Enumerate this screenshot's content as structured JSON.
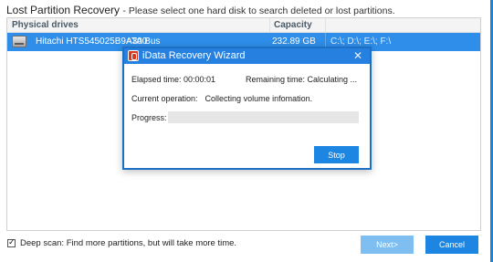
{
  "page": {
    "title": "Lost Partition Recovery",
    "subtitle": "- Please select one hard disk to search deleted or lost partitions."
  },
  "drives_table": {
    "columns": [
      "Physical drives",
      "Capacity"
    ],
    "rows": [
      {
        "name": "Hitachi HTS545025B9A300",
        "bus": "ATA Bus",
        "capacity": "232.89 GB",
        "partitions": "C:\\; D:\\; E:\\; F:\\",
        "icon": "hard-drive-icon",
        "selected": true
      }
    ]
  },
  "dialog": {
    "title": "iData Recovery Wizard",
    "icon": "app-icon",
    "close_glyph": "✕",
    "elapsed": "Elapsed time: 00:00:01",
    "remaining": "Remaining time: Calculating ...",
    "operation_label": "Current operation:",
    "operation_value": "Collecting volume infomation.",
    "progress_label": "Progress:",
    "progress_value": 0,
    "stop_label": "Stop"
  },
  "footer": {
    "deep_scan_checked": true,
    "deep_scan_label": "Deep scan: Find more partitions, but will take more time.",
    "next_label": "Next>",
    "cancel_label": "Cancel"
  },
  "colors": {
    "accent": "#1d86e2",
    "selection": "#2e8ee9",
    "disabled_button": "#7fbef0"
  }
}
